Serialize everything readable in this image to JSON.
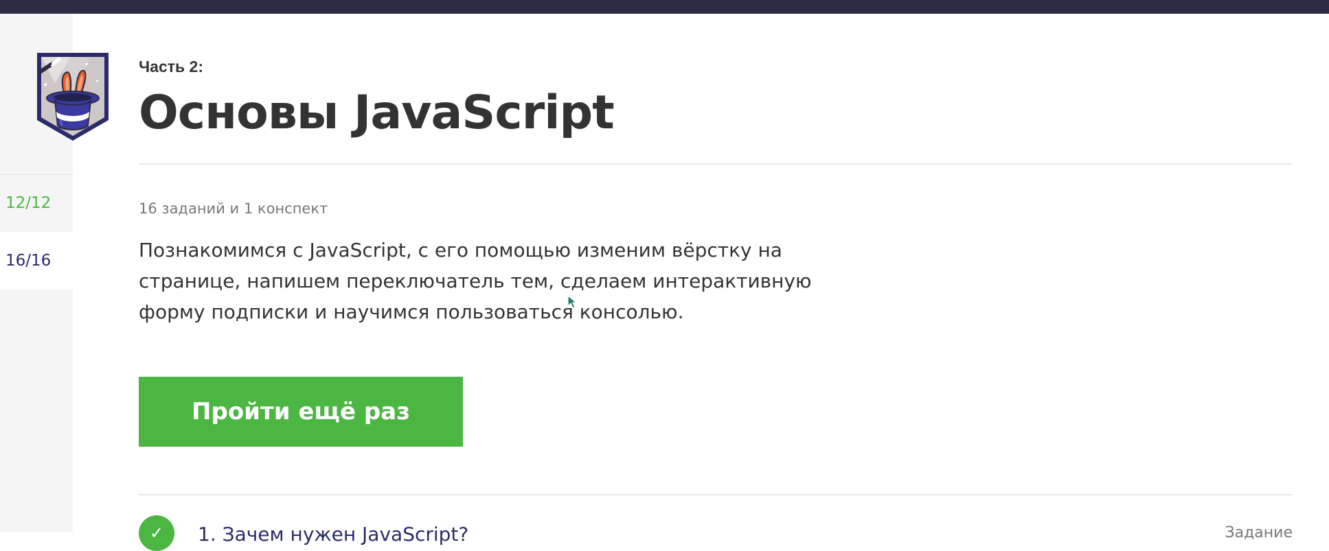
{
  "sidebar": {
    "progress_items": [
      {
        "label": "12/12",
        "status": "done"
      },
      {
        "label": "16/16",
        "status": "active"
      }
    ]
  },
  "header": {
    "part_label": "Часть 2:",
    "title": "Основы JavaScript"
  },
  "main": {
    "counts": "16 заданий и 1 конспект",
    "description": "Познакомимся с JavaScript, с его помощью изменим вёрстку на странице, напишем переключатель тем, сделаем интерактивную форму подписки и научимся пользоваться консолью.",
    "cta_label": "Пройти ещё раз"
  },
  "tasks": [
    {
      "title": "1. Зачем нужен JavaScript?",
      "type": "Задание",
      "check_icon": "checkmark-icon"
    }
  ],
  "colors": {
    "topbar": "#2b2b43",
    "accent_green": "#4cb643",
    "link_navy": "#2b2b6b",
    "text": "#333333",
    "muted": "#777777"
  },
  "icons": {
    "badge": "magic-hat-rabbit-icon",
    "cursor": "mouse-cursor-icon"
  }
}
